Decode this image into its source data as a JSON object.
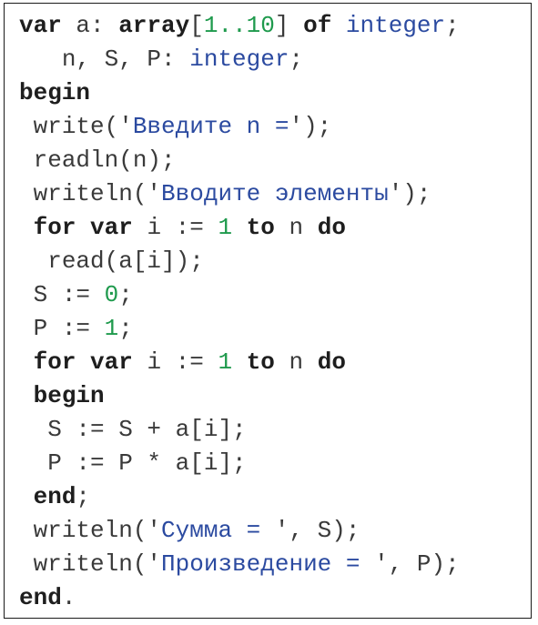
{
  "colors": {
    "keyword": "#1e1e1e",
    "string": "#2b4aa0",
    "number": "#1f9a4d",
    "type": "#2b4aa0",
    "plain": "#3a3a3a",
    "border": "#1a1a1a"
  },
  "code_lines": [
    {
      "indent": "",
      "tokens": [
        {
          "t": "kw",
          "v": "var"
        },
        {
          "t": "plain",
          "v": " a: "
        },
        {
          "t": "kw",
          "v": "array"
        },
        {
          "t": "plain",
          "v": "["
        },
        {
          "t": "num",
          "v": "1..10"
        },
        {
          "t": "plain",
          "v": "] "
        },
        {
          "t": "kw",
          "v": "of"
        },
        {
          "t": "plain",
          "v": " "
        },
        {
          "t": "type",
          "v": "integer"
        },
        {
          "t": "plain",
          "v": ";"
        }
      ]
    },
    {
      "indent": "   ",
      "tokens": [
        {
          "t": "plain",
          "v": "n, S, P: "
        },
        {
          "t": "type",
          "v": "integer"
        },
        {
          "t": "plain",
          "v": ";"
        }
      ]
    },
    {
      "indent": "",
      "tokens": [
        {
          "t": "kw",
          "v": "begin"
        }
      ]
    },
    {
      "indent": " ",
      "tokens": [
        {
          "t": "plain",
          "v": "write('"
        },
        {
          "t": "str",
          "v": "Введите n ="
        },
        {
          "t": "plain",
          "v": "');"
        }
      ]
    },
    {
      "indent": " ",
      "tokens": [
        {
          "t": "plain",
          "v": "readln(n);"
        }
      ]
    },
    {
      "indent": " ",
      "tokens": [
        {
          "t": "plain",
          "v": "writeln('"
        },
        {
          "t": "str",
          "v": "Вводите элементы"
        },
        {
          "t": "plain",
          "v": "');"
        }
      ]
    },
    {
      "indent": " ",
      "tokens": [
        {
          "t": "kw",
          "v": "for"
        },
        {
          "t": "plain",
          "v": " "
        },
        {
          "t": "kw",
          "v": "var"
        },
        {
          "t": "plain",
          "v": " i := "
        },
        {
          "t": "num",
          "v": "1"
        },
        {
          "t": "plain",
          "v": " "
        },
        {
          "t": "kw",
          "v": "to"
        },
        {
          "t": "plain",
          "v": " n "
        },
        {
          "t": "kw",
          "v": "do"
        }
      ]
    },
    {
      "indent": "  ",
      "tokens": [
        {
          "t": "plain",
          "v": "read(a[i]);"
        }
      ]
    },
    {
      "indent": " ",
      "tokens": [
        {
          "t": "plain",
          "v": "S := "
        },
        {
          "t": "num",
          "v": "0"
        },
        {
          "t": "plain",
          "v": ";"
        }
      ]
    },
    {
      "indent": " ",
      "tokens": [
        {
          "t": "plain",
          "v": "P := "
        },
        {
          "t": "num",
          "v": "1"
        },
        {
          "t": "plain",
          "v": ";"
        }
      ]
    },
    {
      "indent": " ",
      "tokens": [
        {
          "t": "kw",
          "v": "for"
        },
        {
          "t": "plain",
          "v": " "
        },
        {
          "t": "kw",
          "v": "var"
        },
        {
          "t": "plain",
          "v": " i := "
        },
        {
          "t": "num",
          "v": "1"
        },
        {
          "t": "plain",
          "v": " "
        },
        {
          "t": "kw",
          "v": "to"
        },
        {
          "t": "plain",
          "v": " n "
        },
        {
          "t": "kw",
          "v": "do"
        }
      ]
    },
    {
      "indent": " ",
      "tokens": [
        {
          "t": "kw",
          "v": "begin"
        }
      ]
    },
    {
      "indent": "  ",
      "tokens": [
        {
          "t": "plain",
          "v": "S := S + a[i];"
        }
      ]
    },
    {
      "indent": "  ",
      "tokens": [
        {
          "t": "plain",
          "v": "P := P * a[i];"
        }
      ]
    },
    {
      "indent": " ",
      "tokens": [
        {
          "t": "kw",
          "v": "end"
        },
        {
          "t": "plain",
          "v": ";"
        }
      ]
    },
    {
      "indent": " ",
      "tokens": [
        {
          "t": "plain",
          "v": "writeln('"
        },
        {
          "t": "str",
          "v": "Сумма = "
        },
        {
          "t": "plain",
          "v": "', S);"
        }
      ]
    },
    {
      "indent": " ",
      "tokens": [
        {
          "t": "plain",
          "v": "writeln('"
        },
        {
          "t": "str",
          "v": "Произведение = "
        },
        {
          "t": "plain",
          "v": "', P);"
        }
      ]
    },
    {
      "indent": "",
      "tokens": [
        {
          "t": "kw",
          "v": "end"
        },
        {
          "t": "plain",
          "v": "."
        }
      ]
    }
  ]
}
